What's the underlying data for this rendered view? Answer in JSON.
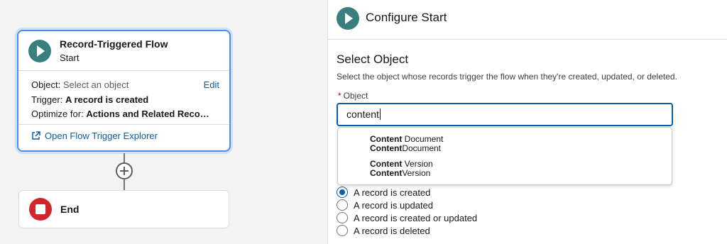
{
  "flow": {
    "start_title": "Record-Triggered Flow",
    "start_subtitle": "Start",
    "object_label": "Object:",
    "object_value": "Select an object",
    "edit_label": "Edit",
    "trigger_label": "Trigger:",
    "trigger_value": "A record is created",
    "optimize_label": "Optimize for:",
    "optimize_value": "Actions and Related Records",
    "explorer_link": "Open Flow Trigger Explorer",
    "end_label": "End"
  },
  "panel": {
    "title": "Configure Start",
    "section_title": "Select Object",
    "section_desc": "Select the object whose records trigger the flow when they're created, updated, or deleted.",
    "object_field_label": "Object",
    "object_field_value": "content"
  },
  "dropdown": [
    {
      "label_bold": "Content",
      "label_rest": " Document",
      "api_bold": "Content",
      "api_rest": "Document"
    },
    {
      "label_bold": "Content",
      "label_rest": " Version",
      "api_bold": "Content",
      "api_rest": "Version"
    }
  ],
  "trigger_options": [
    {
      "label": "A record is created",
      "selected": true
    },
    {
      "label": "A record is updated",
      "selected": false
    },
    {
      "label": "A record is created or updated",
      "selected": false
    },
    {
      "label": "A record is deleted",
      "selected": false
    }
  ],
  "colors": {
    "accent": "#0b5cab",
    "start_icon": "#3a7f7f",
    "end_icon": "#d2262f"
  }
}
